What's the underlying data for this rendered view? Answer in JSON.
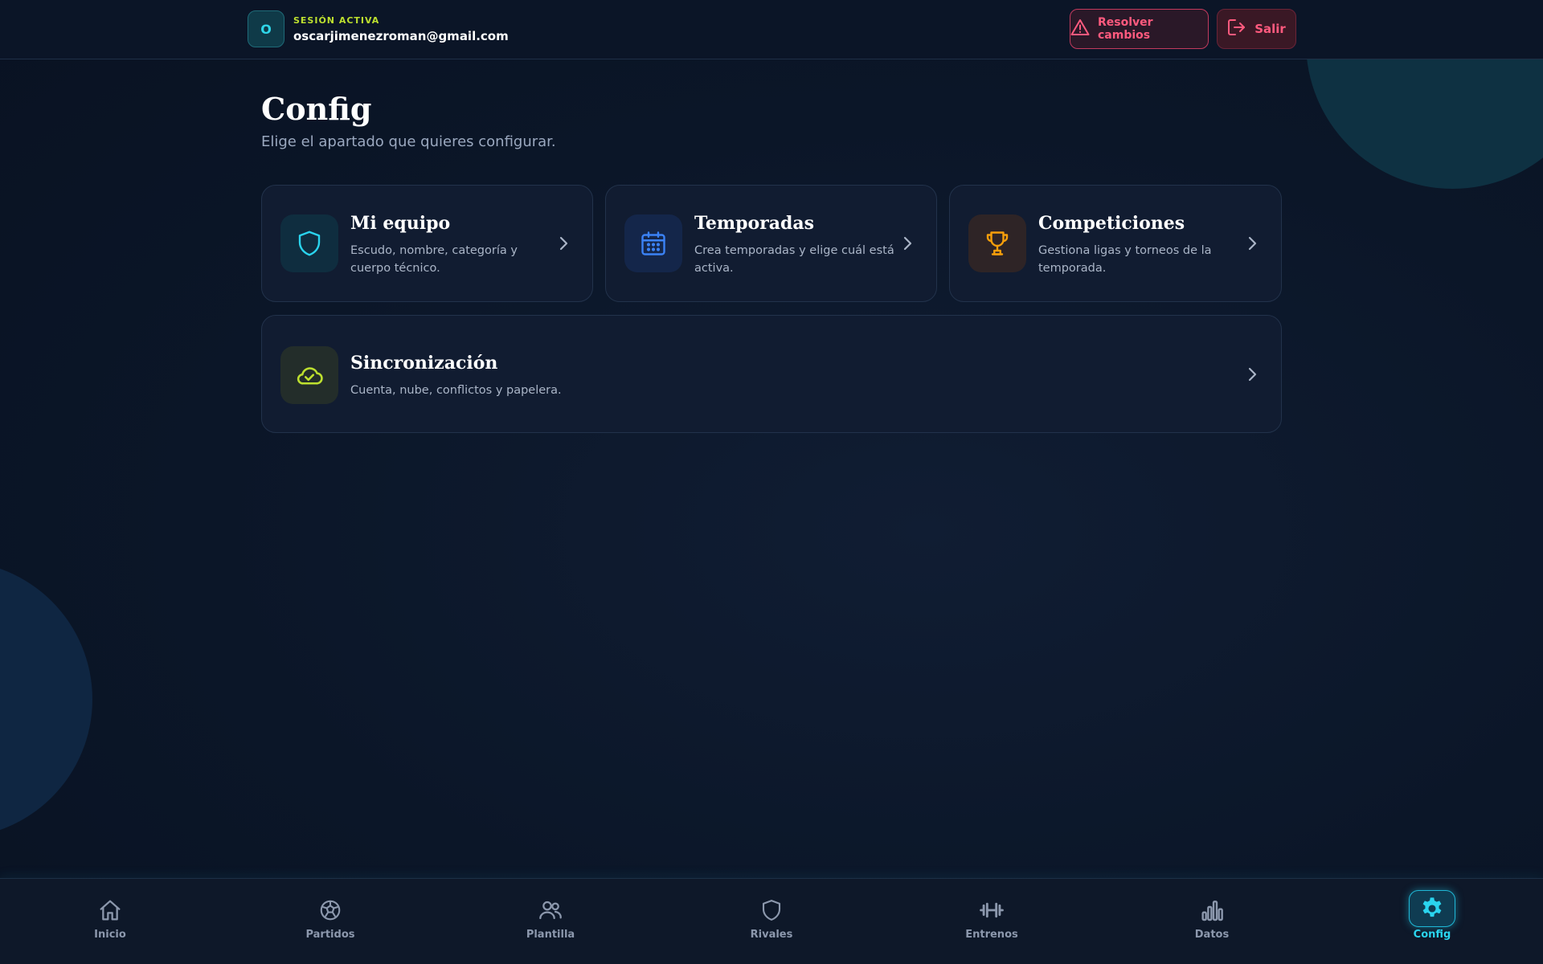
{
  "header": {
    "avatar_initial": "O",
    "session_label": "SESIÓN ACTIVA",
    "email": "oscarjimenezroman@gmail.com",
    "resolve_label": "Resolver cambios",
    "exit_label": "Salir"
  },
  "page": {
    "title": "Config",
    "subtitle": "Elige el apartado que quieres configurar."
  },
  "cards": [
    {
      "title": "Mi equipo",
      "desc_line1": "Escudo, nombre, categoría y",
      "desc_line2": "cuerpo técnico.",
      "icon": "shield-icon"
    },
    {
      "title": "Temporadas",
      "desc_line1": "Crea temporadas y elige cuál está",
      "desc_line2": "activa.",
      "icon": "calendar-icon"
    },
    {
      "title": "Competiciones",
      "desc_line1": "Gestiona ligas y torneos de la",
      "desc_line2": "temporada.",
      "icon": "trophy-icon"
    },
    {
      "title": "Sincronización",
      "desc_line1": "Cuenta, nube, conflictos y papelera.",
      "icon": "cloud-check-icon"
    }
  ],
  "nav": [
    {
      "label": "Inicio",
      "icon": "home-icon"
    },
    {
      "label": "Partidos",
      "icon": "soccer-ball-icon"
    },
    {
      "label": "Plantilla",
      "icon": "users-icon"
    },
    {
      "label": "Rivales",
      "icon": "shield-icon"
    },
    {
      "label": "Entrenos",
      "icon": "dumbbell-icon"
    },
    {
      "label": "Datos",
      "icon": "bar-chart-icon"
    },
    {
      "label": "Config",
      "icon": "gear-icon",
      "active": true
    }
  ],
  "colors": {
    "accent_cyan": "#2ad4ee",
    "accent_lime": "#bde02f",
    "danger": "#ff5a7e",
    "calendar_blue": "#3b82f6",
    "trophy_orange": "#f59e0b"
  }
}
